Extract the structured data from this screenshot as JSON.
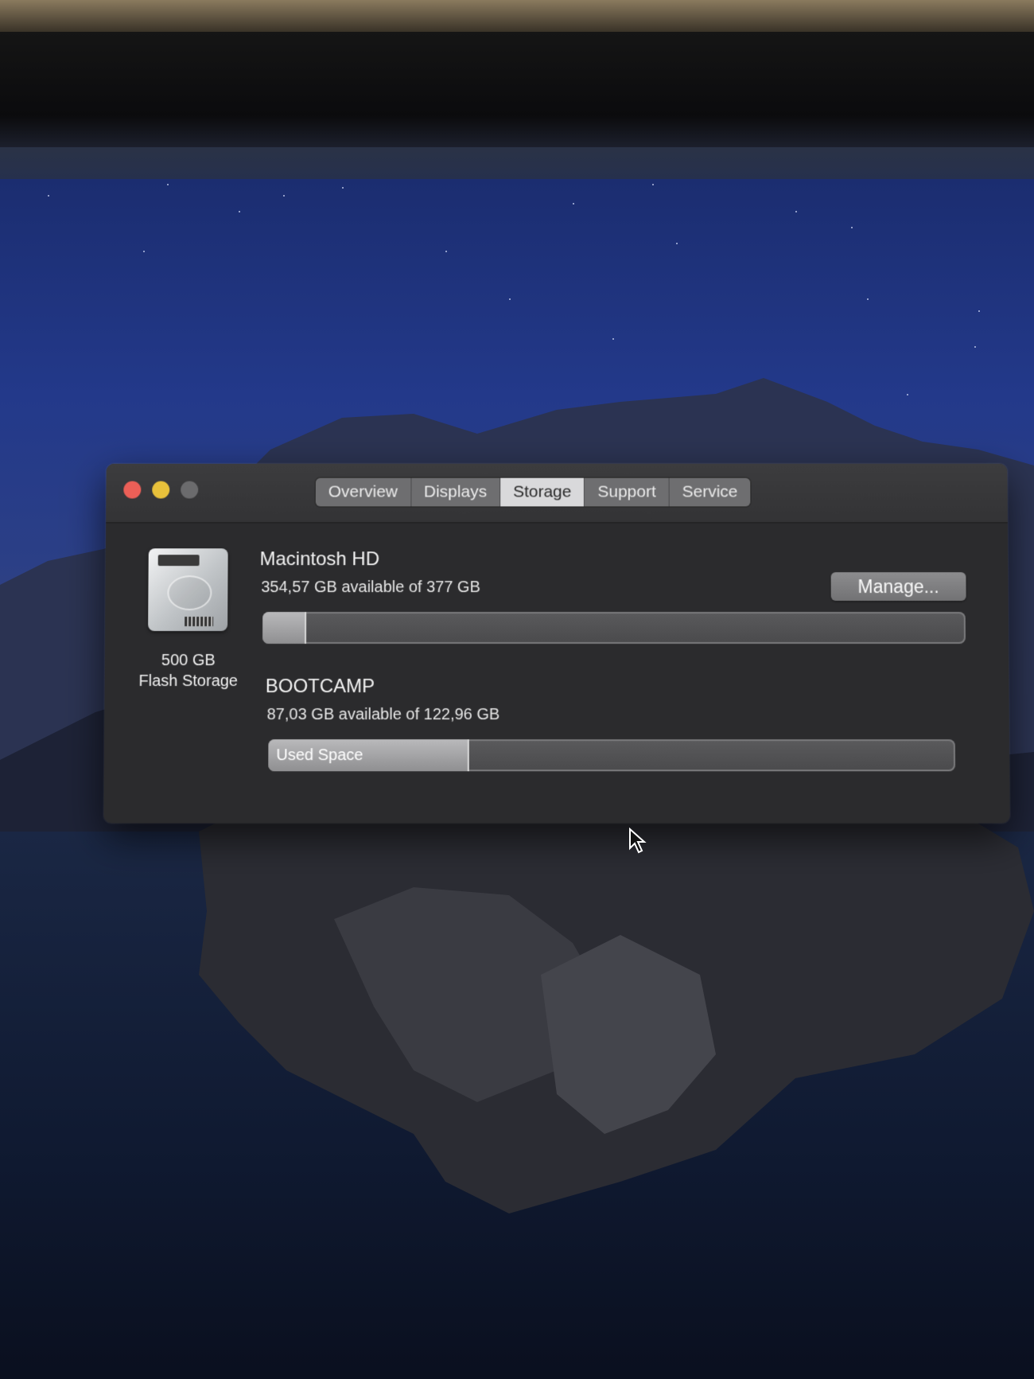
{
  "window": {
    "tabs": [
      {
        "label": "Overview",
        "active": false
      },
      {
        "label": "Displays",
        "active": false
      },
      {
        "label": "Storage",
        "active": true
      },
      {
        "label": "Support",
        "active": false
      },
      {
        "label": "Service",
        "active": false
      }
    ]
  },
  "storage": {
    "device_capacity": "500 GB",
    "device_type": "Flash Storage",
    "manage_label": "Manage...",
    "volumes": [
      {
        "name": "Macintosh HD",
        "availability": "354,57 GB available of 377 GB",
        "used_fraction": 0.06,
        "used_label": ""
      },
      {
        "name": "BOOTCAMP",
        "availability": "87,03 GB available of 122,96 GB",
        "used_fraction": 0.29,
        "used_label": "Used Space"
      }
    ]
  },
  "colors": {
    "close": "#ec5f57",
    "minimize": "#e8c13b",
    "zoom_disabled": "#6b6b6d",
    "window_bg": "#2b2b2d",
    "tab_active_bg": "#d9d9db"
  },
  "icons": [
    "close-icon",
    "minimize-icon",
    "zoom-icon",
    "hard-drive-icon",
    "pointer-cursor-icon"
  ]
}
